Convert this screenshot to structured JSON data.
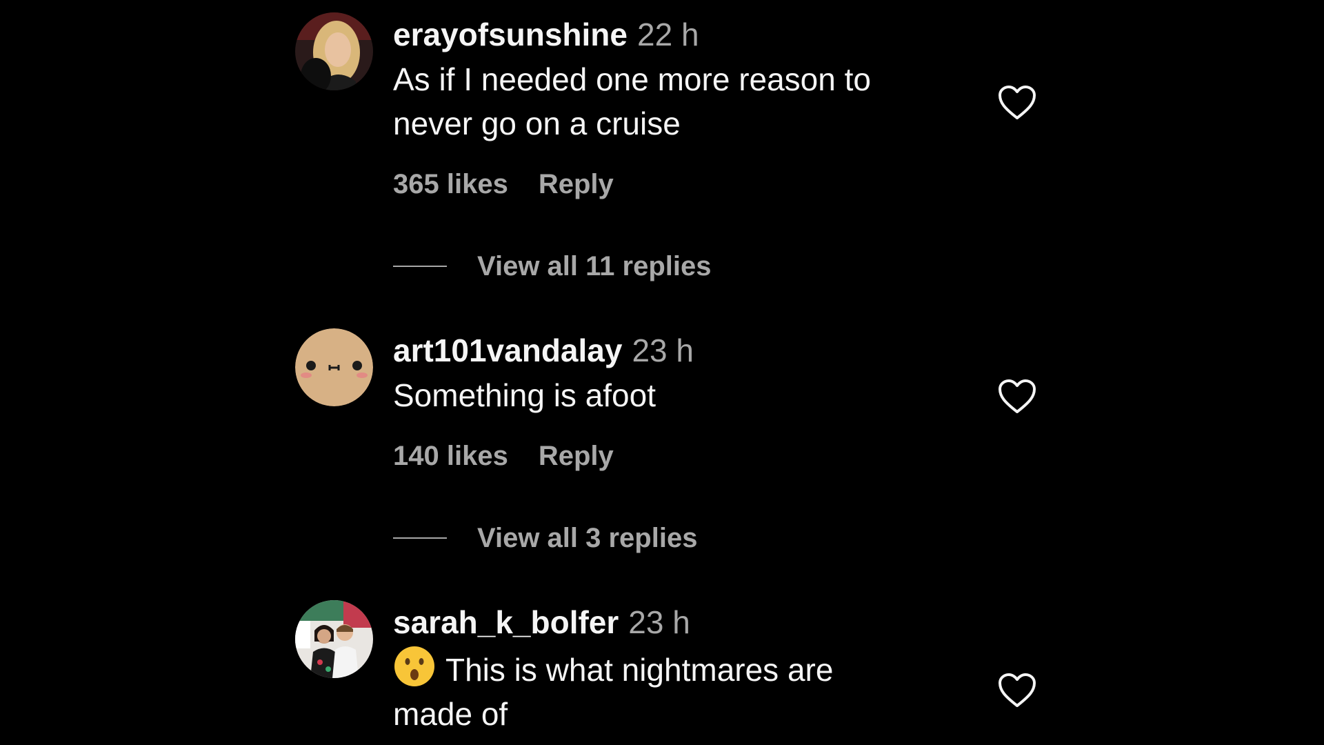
{
  "comments": [
    {
      "username": "erayofsunshine",
      "time": "22 h",
      "text_line1": "As if I needed one more reason to",
      "text_line2": "never go on a cruise",
      "likes": "365 likes",
      "reply_label": "Reply",
      "view_replies": "View all 11 replies",
      "avatar_icon": "profile-photo-woman-blonde"
    },
    {
      "username": "art101vandalay",
      "time": "23 h",
      "text_line1": "Something is afoot",
      "likes": "140 likes",
      "reply_label": "Reply",
      "view_replies": "View all 3 replies",
      "avatar_icon": "cute-face-avatar"
    },
    {
      "username": "sarah_k_bolfer",
      "time": "23 h",
      "emoji_icon": "astonished-face-emoji",
      "text_line1": "This is what nightmares are",
      "text_line2": "made of",
      "avatar_icon": "profile-photo-couple"
    }
  ],
  "colors": {
    "background": "#000000",
    "primary_text": "#f5f5f5",
    "secondary_text": "#a8a8a8"
  }
}
